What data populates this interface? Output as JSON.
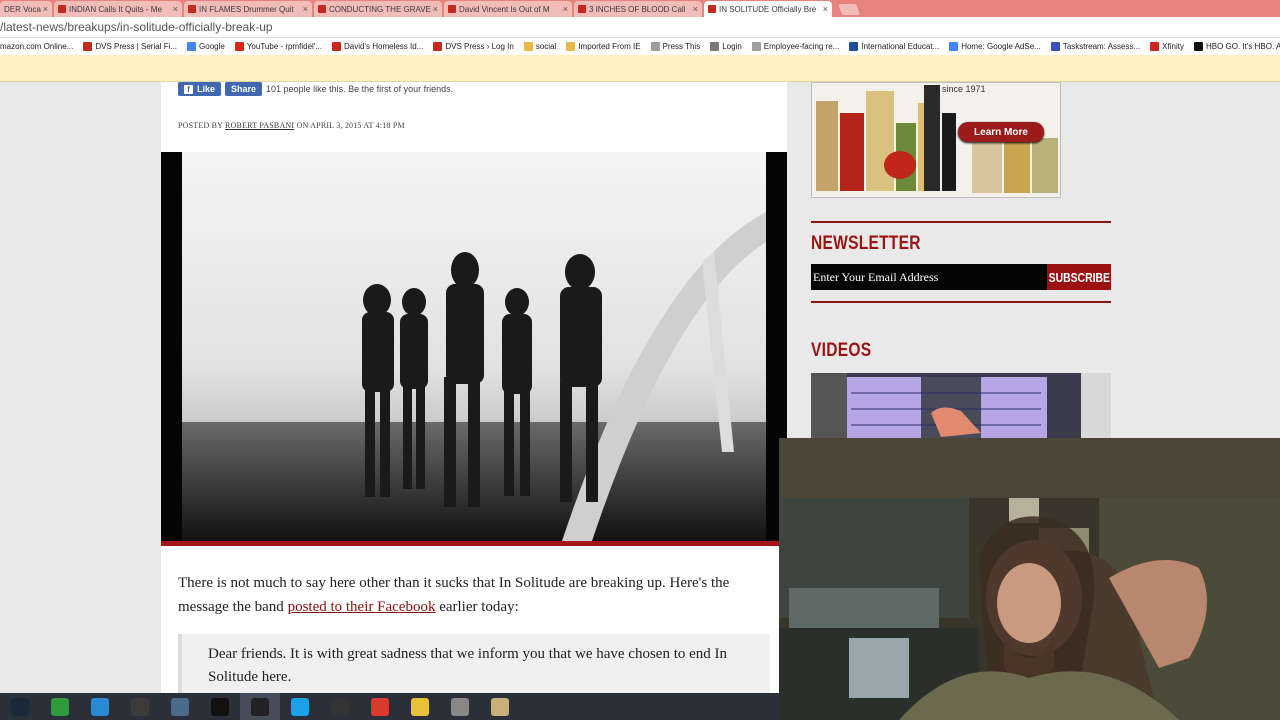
{
  "browser": {
    "tabs": [
      {
        "title": "DER Voca",
        "active": false
      },
      {
        "title": "INDIAN Calls It Quits - Me",
        "active": false
      },
      {
        "title": "IN FLAMES Drummer Quit",
        "active": false
      },
      {
        "title": "CONDUCTING THE GRAVE",
        "active": false
      },
      {
        "title": "David Vincent Is Out of M",
        "active": false
      },
      {
        "title": "3 INCHES OF BLOOD Call",
        "active": false
      },
      {
        "title": "IN SOLITUDE Officially Bre",
        "active": true
      }
    ],
    "close_glyph": "×",
    "address": "/latest-news/breakups/in-solitude-officially-break-up",
    "bookmarks": [
      {
        "label": "mazon.com Online...",
        "icon": "amazon-icon",
        "color": "#ffffff"
      },
      {
        "label": "DVS Press | Serial Fi...",
        "icon": "dvs-icon",
        "color": "#c62a1f"
      },
      {
        "label": "Google",
        "icon": "google-icon",
        "color": "#4285f4"
      },
      {
        "label": "YouTube - rpmfidel'...",
        "icon": "youtube-icon",
        "color": "#e62117"
      },
      {
        "label": "David's Homeless Id...",
        "icon": "bookmark-icon",
        "color": "#c62a1f"
      },
      {
        "label": "DVS Press › Log In",
        "icon": "dvs-icon",
        "color": "#c62a1f"
      },
      {
        "label": "social",
        "icon": "folder-icon",
        "color": "#e8b84a"
      },
      {
        "label": "Imported From IE",
        "icon": "folder-icon",
        "color": "#e8b84a"
      },
      {
        "label": "Press This",
        "icon": "page-icon",
        "color": "#9e9e9e"
      },
      {
        "label": "Login",
        "icon": "login-icon",
        "color": "#777777"
      },
      {
        "label": "Employee-facing re...",
        "icon": "page-icon",
        "color": "#9e9e9e"
      },
      {
        "label": "International Educat...",
        "icon": "iie-icon",
        "color": "#1f4e9c"
      },
      {
        "label": "Home: Google AdSe...",
        "icon": "google-icon",
        "color": "#4285f4"
      },
      {
        "label": "Taskstream: Assess...",
        "icon": "taskstream-icon",
        "color": "#3b4fbf"
      },
      {
        "label": "Xfinity",
        "icon": "xfinity-icon",
        "color": "#c62a1f"
      },
      {
        "label": "HBO GO. It's HBO. A...",
        "icon": "hbo-icon",
        "color": "#111111"
      }
    ]
  },
  "article": {
    "fb_like": "Like",
    "fb_share": "Share",
    "fb_like_glyph": "f",
    "likes_text": "101 people like this. Be the first of your friends.",
    "posted_by_prefix": "POSTED BY",
    "author": "ROBERT PASBANI",
    "posted_on": "ON APRIL 3, 2015 AT 4:18 PM",
    "para1_pre": "There is not much to say here other than it sucks that In Solitude are breaking up. Here's the message the band",
    "para1_link": "posted to their Facebook",
    "para1_post": "earlier today:",
    "quote": "Dear friends. It is with great sadness that we inform you that we have chosen to end In Solitude here."
  },
  "sidebar": {
    "ad_since": "since 1971",
    "ad_button": "Learn More",
    "newsletter_title": "NEWSLETTER",
    "email_placeholder": "Enter Your Email Address",
    "subscribe": "SUBSCRIBE",
    "videos_title": "VIDEOS"
  },
  "taskbar": [
    {
      "icon": "steam-icon",
      "color": "#1b2838",
      "active": false
    },
    {
      "icon": "store-icon",
      "color": "#2e9a3c",
      "active": false
    },
    {
      "icon": "ie-icon",
      "color": "#2a8ad4",
      "active": false
    },
    {
      "icon": "app-icon",
      "color": "#3b3b3b",
      "active": false
    },
    {
      "icon": "app-icon",
      "color": "#4b6b8b",
      "active": false
    },
    {
      "icon": "terminal-icon",
      "color": "#111111",
      "active": false
    },
    {
      "icon": "obs-icon",
      "color": "#222222",
      "active": true
    },
    {
      "icon": "skype-icon",
      "color": "#1aa3e8",
      "active": false
    },
    {
      "icon": "app-icon",
      "color": "#333333",
      "active": false
    },
    {
      "icon": "chrome-icon",
      "color": "#d93c2f",
      "active": false
    },
    {
      "icon": "live-icon",
      "color": "#e8c23a",
      "active": false
    },
    {
      "icon": "camera-icon",
      "color": "#888888",
      "active": false
    },
    {
      "icon": "audio-icon",
      "color": "#c9b07a",
      "active": false
    }
  ]
}
